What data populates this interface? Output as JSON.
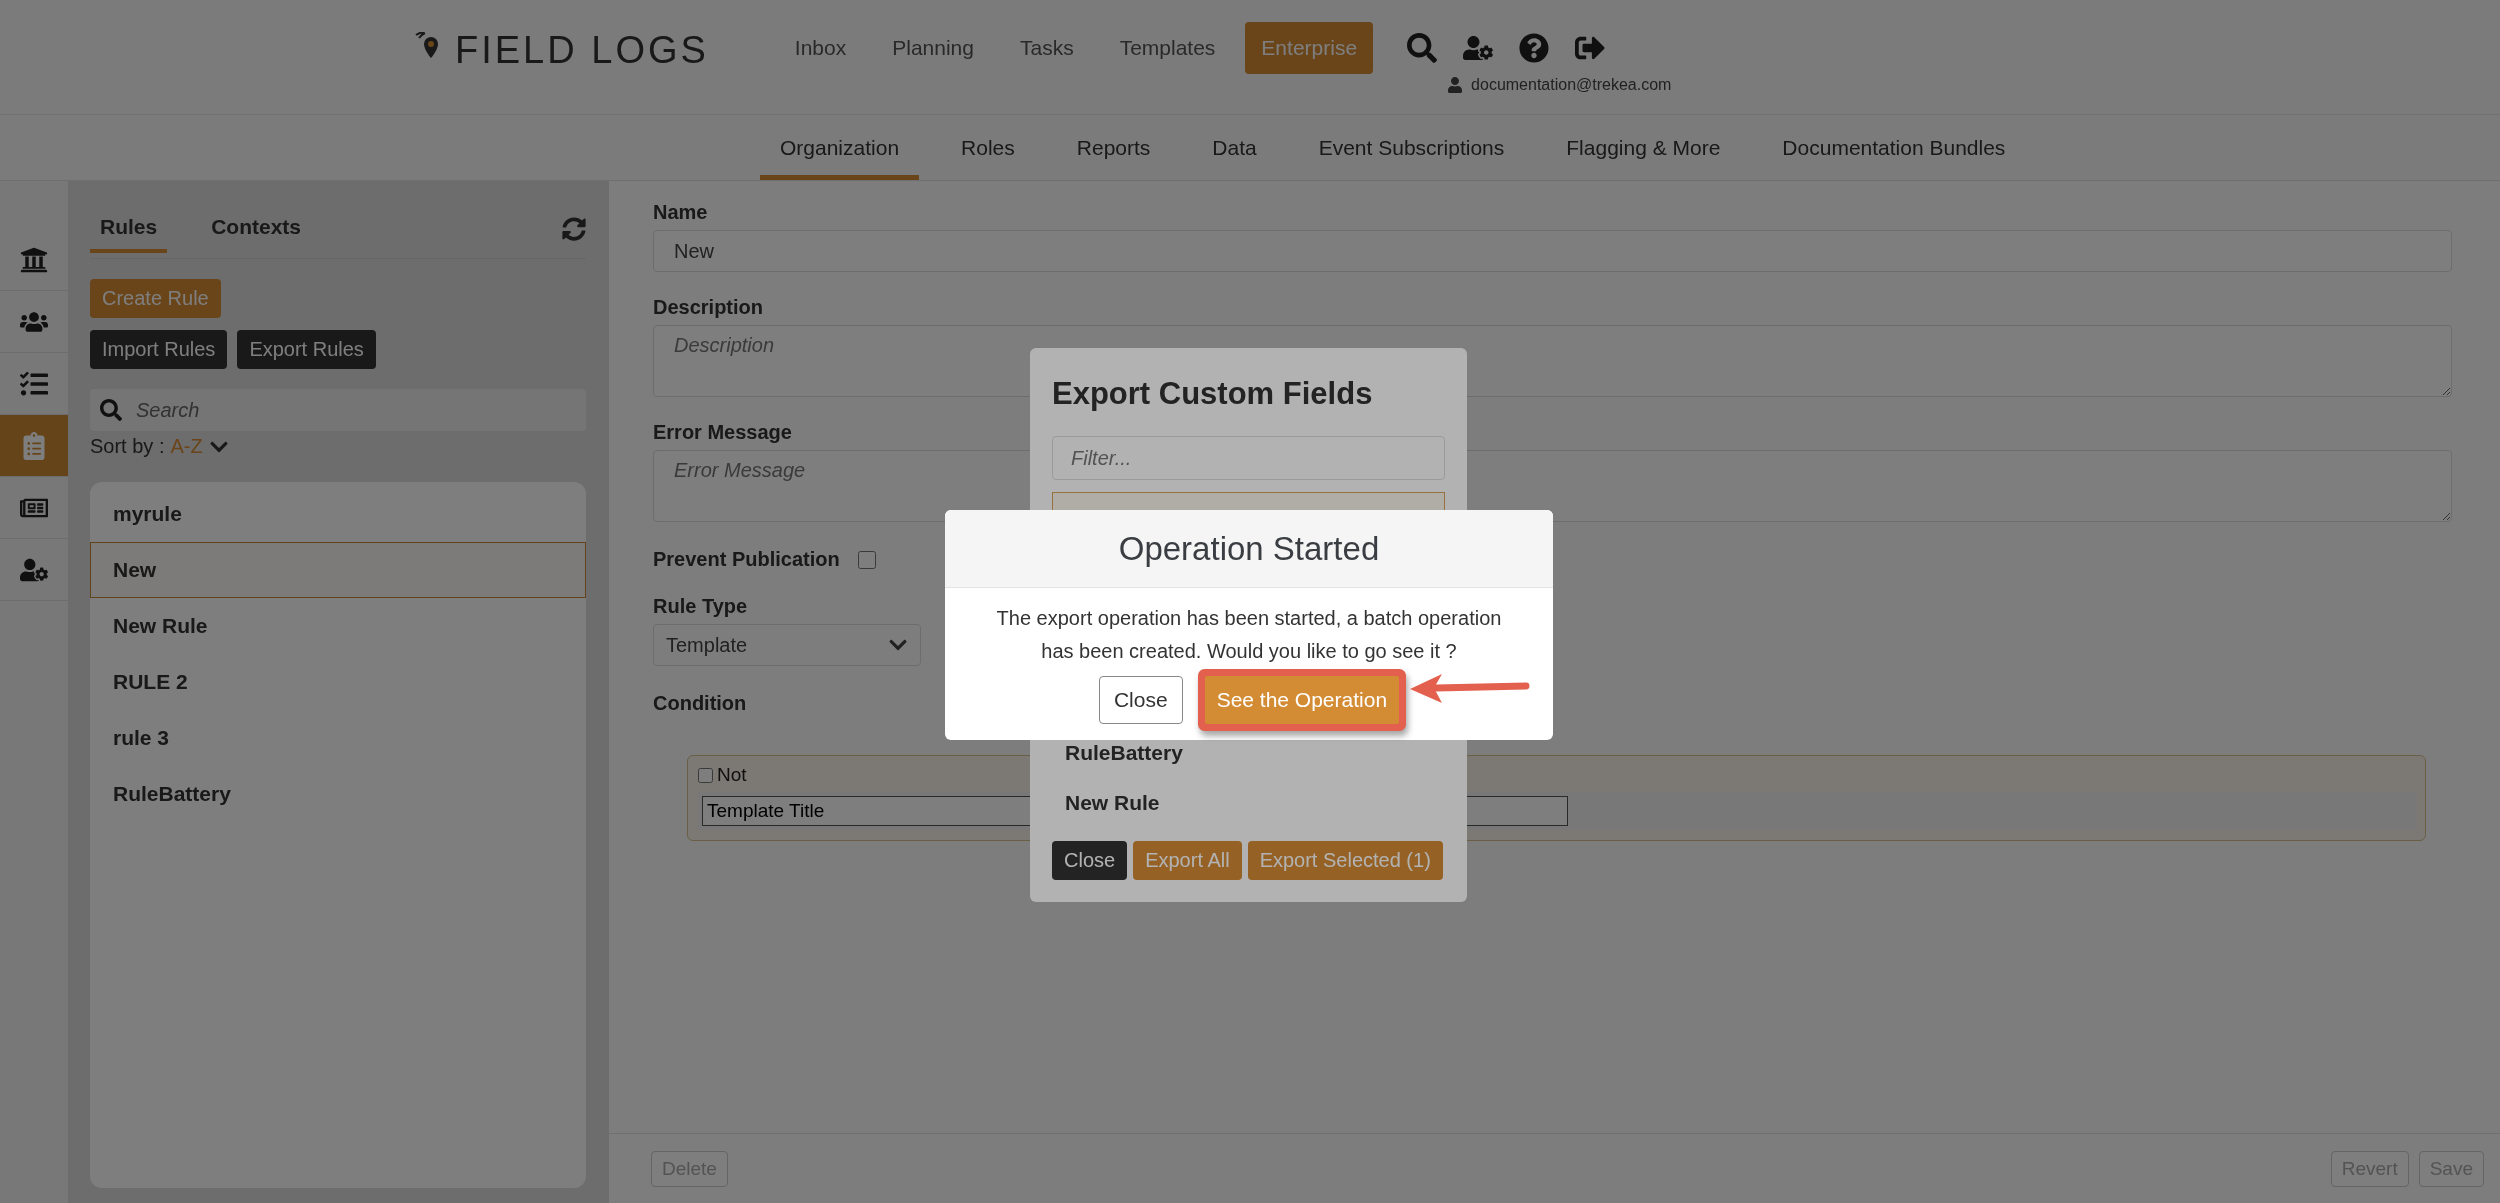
{
  "header": {
    "logo": "FIELD LOGS",
    "nav": [
      {
        "label": "Inbox",
        "selected": false
      },
      {
        "label": "Planning",
        "selected": false
      },
      {
        "label": "Tasks",
        "selected": false
      },
      {
        "label": "Templates",
        "selected": false
      },
      {
        "label": "Enterprise",
        "selected": true
      }
    ],
    "user_email": "documentation@trekea.com"
  },
  "subnav": [
    {
      "label": "Organization",
      "selected": true
    },
    {
      "label": "Roles",
      "selected": false
    },
    {
      "label": "Reports",
      "selected": false
    },
    {
      "label": "Data",
      "selected": false
    },
    {
      "label": "Event Subscriptions",
      "selected": false
    },
    {
      "label": "Flagging & More",
      "selected": false
    },
    {
      "label": "Documentation Bundles",
      "selected": false
    }
  ],
  "rail": [
    {
      "kind": "bank",
      "selected": false
    },
    {
      "kind": "users",
      "selected": false
    },
    {
      "kind": "checklist",
      "selected": false
    },
    {
      "kind": "clipboard",
      "selected": true
    },
    {
      "kind": "form",
      "selected": false
    },
    {
      "kind": "user-settings",
      "selected": false
    }
  ],
  "rules_panel": {
    "tabs": [
      {
        "label": "Rules",
        "selected": true
      },
      {
        "label": "Contexts",
        "selected": false
      }
    ],
    "create_button": "Create Rule",
    "import_button": "Import Rules",
    "export_button": "Export Rules",
    "search": {
      "placeholder": "Search"
    },
    "sort_label": "Sort by :",
    "sort_value": "A-Z",
    "rules": [
      {
        "label": "myrule",
        "selected": false
      },
      {
        "label": "New",
        "selected": true
      },
      {
        "label": "New Rule",
        "selected": false
      },
      {
        "label": "RULE 2",
        "selected": false
      },
      {
        "label": "rule 3",
        "selected": false
      },
      {
        "label": "RuleBattery",
        "selected": false
      }
    ]
  },
  "form": {
    "name": {
      "label": "Name",
      "value": "New"
    },
    "description": {
      "label": "Description",
      "placeholder": "Description"
    },
    "error_message": {
      "label": "Error Message",
      "placeholder": "Error Message"
    },
    "prevent_publication": {
      "label": "Prevent Publication",
      "checked": false
    },
    "rule_type": {
      "label": "Rule Type",
      "value": "Template"
    },
    "condition": {
      "label": "Condition",
      "not": {
        "label": "Not",
        "checked": false
      },
      "field": {
        "value": "Template Title"
      }
    }
  },
  "footer": {
    "delete": {
      "label": "Delete",
      "disabled": true
    },
    "revert": {
      "label": "Revert",
      "disabled": true
    },
    "save": {
      "label": "Save",
      "disabled": true
    }
  },
  "export_dialog": {
    "title": "Export Custom Fields",
    "filter": {
      "placeholder": "Filter..."
    },
    "items": [
      {
        "selected": true
      },
      {
        "label": "RuleBattery",
        "selected": false
      },
      {
        "label": "New Rule",
        "selected": false
      }
    ],
    "close_button": "Close",
    "export_all_button": "Export All",
    "export_selected_button": "Export Selected (1)"
  },
  "operation_dialog": {
    "title": "Operation Started",
    "message": "The export operation has been started, a batch operation has been created. Would you like to go see it ?",
    "close_button": "Close",
    "see_button": {
      "label": "See the Operation",
      "highlighted": true
    }
  }
}
